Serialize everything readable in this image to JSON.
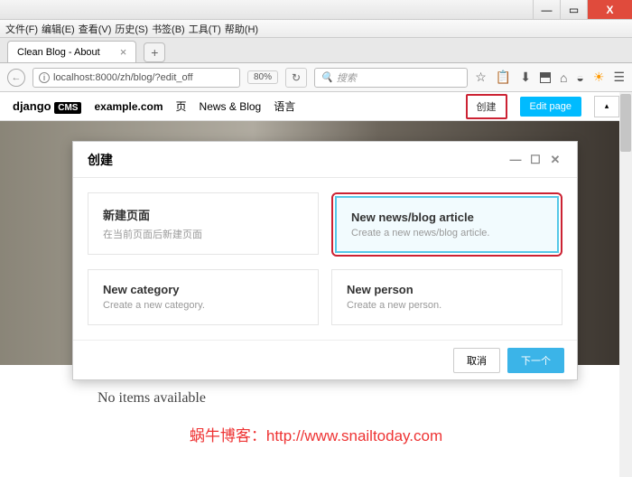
{
  "window": {
    "min": "—",
    "max": "▭",
    "close": "X"
  },
  "menus": [
    "文件(F)",
    "编辑(E)",
    "查看(V)",
    "历史(S)",
    "书签(B)",
    "工具(T)",
    "帮助(H)"
  ],
  "tab": {
    "title": "Clean Blog - About"
  },
  "url": "localhost:8000/zh/blog/?edit_off",
  "zoom": "80%",
  "search_placeholder": "搜索",
  "cms": {
    "logo1": "django",
    "logo2": "CMS",
    "site": "example.com",
    "nav": [
      "页",
      "News & Blog",
      "语言"
    ],
    "create": "创建",
    "edit": "Edit page"
  },
  "modal": {
    "title": "创建",
    "cards": [
      {
        "title": "新建页面",
        "desc": "在当前页面后新建页面"
      },
      {
        "title": "New news/blog article",
        "desc": "Create a new news/blog article."
      },
      {
        "title": "New category",
        "desc": "Create a new category."
      },
      {
        "title": "New person",
        "desc": "Create a new person."
      }
    ],
    "cancel": "取消",
    "next": "下一个"
  },
  "page": {
    "noitems": "No items available"
  },
  "watermark": {
    "label": "蜗牛博客：",
    "url": "http://www.snailtoday.com"
  }
}
